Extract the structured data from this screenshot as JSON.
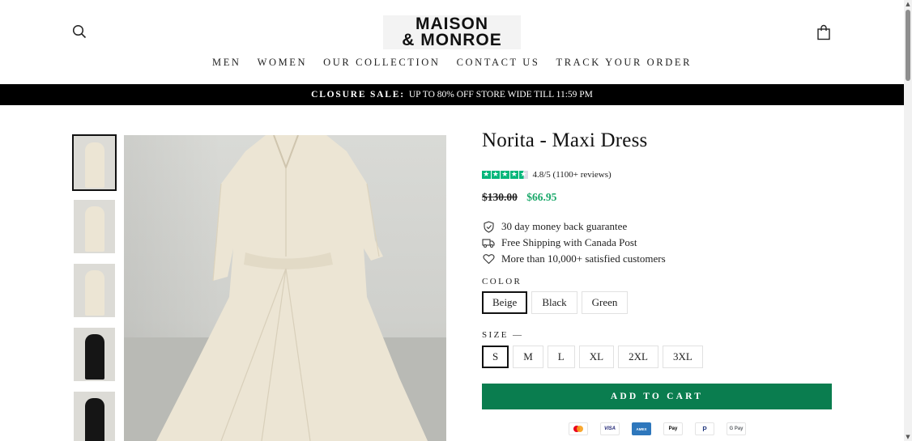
{
  "header": {
    "logo_line1": "MAISON",
    "logo_line2": "& MONROE",
    "search_icon": "search-icon",
    "cart_icon": "shopping-bag-icon"
  },
  "nav": {
    "items": [
      "MEN",
      "WOMEN",
      "OUR COLLECTION",
      "CONTACT US",
      "TRACK YOUR ORDER"
    ]
  },
  "announcement": {
    "bold": "CLOSURE SALE:",
    "text": "UP TO 80% OFF STORE WIDE TILL 11:59 PM"
  },
  "gallery": {
    "thumbnails": [
      {
        "variant": "beige",
        "active": true
      },
      {
        "variant": "beige",
        "active": false
      },
      {
        "variant": "beige",
        "active": false
      },
      {
        "variant": "black",
        "active": false
      },
      {
        "variant": "black",
        "active": false
      }
    ]
  },
  "product": {
    "title": "Norita - Maxi Dress",
    "rating_text": "4.8/5 (1100+ reviews)",
    "rating_value": 4.8,
    "old_price": "$130.00",
    "new_price": "$66.95",
    "features": [
      {
        "icon": "shield-check-icon",
        "text": "30 day money back guarantee"
      },
      {
        "icon": "truck-icon",
        "text": "Free Shipping with Canada Post"
      },
      {
        "icon": "heart-icon",
        "text": "More than 10,000+ satisfied customers"
      }
    ],
    "color_label": "COLOR",
    "colors": [
      "Beige",
      "Black",
      "Green"
    ],
    "selected_color": "Beige",
    "size_label": "SIZE —",
    "sizes": [
      "S",
      "M",
      "L",
      "XL",
      "2XL",
      "3XL"
    ],
    "selected_size": "S",
    "add_to_cart": "ADD TO CART",
    "payment_methods": [
      "mastercard",
      "visa",
      "amex",
      "apple-pay",
      "paypal",
      "google-pay"
    ]
  },
  "colors": {
    "accent_green": "#0a7d4f",
    "sale_price": "#1aa86a",
    "trustpilot_green": "#00b67a",
    "announcement_bg": "#000000"
  }
}
